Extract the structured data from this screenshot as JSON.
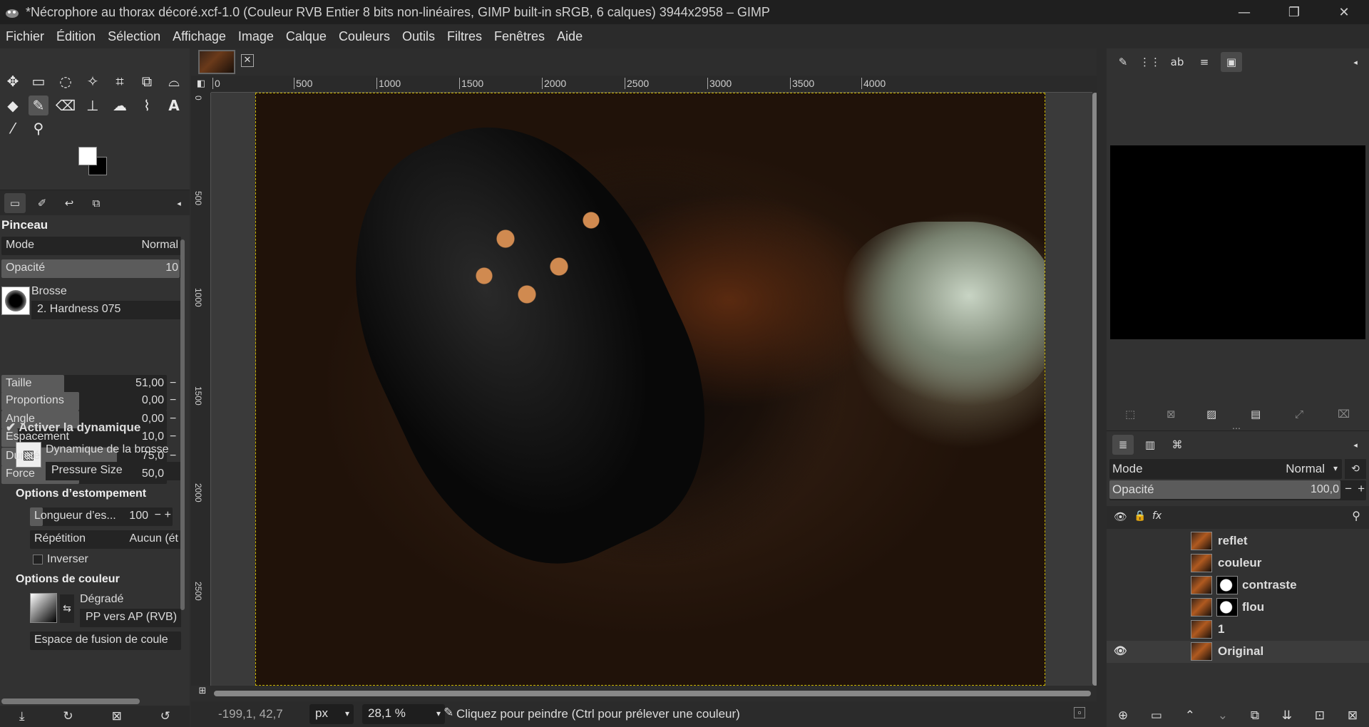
{
  "window": {
    "title": "*Nécrophore au thorax décoré.xcf-1.0 (Couleur RVB Entier 8 bits non-linéaires, GIMP built-in sRGB, 6 calques) 3944x2958 – GIMP",
    "min_icon": "minimize-icon",
    "restore_icon": "restore-icon",
    "close_icon": "close-icon"
  },
  "menu": [
    "Fichier",
    "Édition",
    "Sélection",
    "Affichage",
    "Image",
    "Calque",
    "Couleurs",
    "Outils",
    "Filtres",
    "Fenêtres",
    "Aide"
  ],
  "tool_options": {
    "heading": "Pinceau",
    "mode_label": "Mode",
    "mode_value": "Normal",
    "opacity_label": "Opacité",
    "opacity_value": "10",
    "brush_label": "Brosse",
    "brush_value": "2. Hardness 075",
    "sliders": [
      {
        "label": "Taille",
        "value": "51,00",
        "fraction": 0.38
      },
      {
        "label": "Proportions",
        "value": "0,00",
        "fraction": 0.47
      },
      {
        "label": "Angle",
        "value": "0,00",
        "fraction": 0.47
      },
      {
        "label": "Espacement",
        "value": "10,0",
        "fraction": 0.1
      },
      {
        "label": "Dureté",
        "value": "75,0",
        "fraction": 0.7
      },
      {
        "label": "Force",
        "value": "50,0",
        "fraction": 0.47
      }
    ],
    "dynamics_toggle": "Activer la dynamique",
    "dynamics_label": "Dynamique de la brosse",
    "dynamics_value": "Pressure Size",
    "fade_heading": "Options d’estompement",
    "fade_length_label": "Longueur d’es...",
    "fade_length_value": "100",
    "repeat_label": "Répétition",
    "repeat_value": "Aucun (ét",
    "invert_label": "Inverser",
    "color_heading": "Options de couleur",
    "gradient_label": "Dégradé",
    "gradient_value": "PP vers AP (RVB)",
    "blend_label": "Espace de fusion de coule"
  },
  "ruler_h": [
    "0",
    "500",
    "1000",
    "1500",
    "2000",
    "2500",
    "3000",
    "3500",
    "4000"
  ],
  "ruler_v": [
    "0",
    "500",
    "1000",
    "1500",
    "2000",
    "2500"
  ],
  "status": {
    "coords": "-199,1, 42,7",
    "unit": "px",
    "zoom": "28,1 %",
    "message": "Cliquez pour peindre (Ctrl pour prélever une couleur)"
  },
  "layers_panel": {
    "mode_label": "Mode",
    "mode_value": "Normal",
    "opacity_label": "Opacité",
    "opacity_value": "100,0",
    "layers": [
      {
        "name": "reflet",
        "visible": false,
        "mask": false
      },
      {
        "name": "couleur",
        "visible": false,
        "mask": false
      },
      {
        "name": "contraste",
        "visible": false,
        "mask": true
      },
      {
        "name": "flou",
        "visible": false,
        "mask": true
      },
      {
        "name": "1",
        "visible": false,
        "mask": false
      },
      {
        "name": "Original",
        "visible": true,
        "mask": false
      }
    ]
  }
}
